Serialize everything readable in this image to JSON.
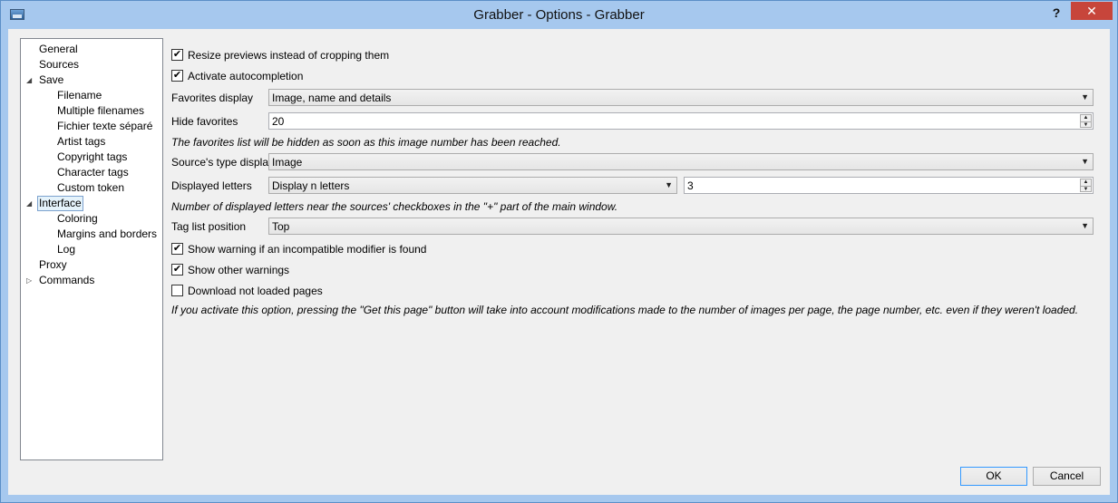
{
  "window": {
    "title": "Grabber - Options - Grabber",
    "help_label": "?",
    "close_label": "✕"
  },
  "tree": [
    {
      "label": "General",
      "arrow": ""
    },
    {
      "label": "Sources",
      "arrow": ""
    },
    {
      "label": "Save",
      "arrow": "◢"
    },
    {
      "label": "Filename",
      "arrow": ""
    },
    {
      "label": "Multiple filenames",
      "arrow": ""
    },
    {
      "label": "Fichier texte séparé",
      "arrow": ""
    },
    {
      "label": "Artist tags",
      "arrow": ""
    },
    {
      "label": "Copyright tags",
      "arrow": ""
    },
    {
      "label": "Character tags",
      "arrow": ""
    },
    {
      "label": "Custom token",
      "arrow": ""
    },
    {
      "label": "Interface",
      "arrow": "◢"
    },
    {
      "label": "Coloring",
      "arrow": ""
    },
    {
      "label": "Margins and borders",
      "arrow": ""
    },
    {
      "label": "Log",
      "arrow": ""
    },
    {
      "label": "Proxy",
      "arrow": ""
    },
    {
      "label": "Commands",
      "arrow": "▷"
    }
  ],
  "selected_tree_item": "Interface",
  "options": {
    "resize_previews": {
      "label": "Resize previews instead of cropping them",
      "checked": "✔"
    },
    "autocompletion": {
      "label": "Activate autocompletion",
      "checked": "✔"
    },
    "favorites_display": {
      "label": "Favorites display",
      "value": "Image, name and details"
    },
    "hide_favorites": {
      "label": "Hide favorites",
      "value": "20"
    },
    "hide_favorites_hint": "The favorites list will be hidden as soon as this image number has been reached.",
    "source_type_display": {
      "label": "Source's type display",
      "value": "Image"
    },
    "displayed_letters": {
      "label": "Displayed letters",
      "mode": "Display n letters",
      "value": "3"
    },
    "displayed_letters_hint": "Number of displayed letters near the sources' checkboxes in the \"+\" part of the main window.",
    "tag_list_position": {
      "label": "Tag list position",
      "value": "Top"
    },
    "incompatible_modifier": {
      "label": "Show warning if an incompatible modifier is found",
      "checked": "✔"
    },
    "other_warnings": {
      "label": "Show other warnings",
      "checked": "✔"
    },
    "download_not_loaded": {
      "label": "Download not loaded pages",
      "checked": ""
    },
    "download_hint": "If you activate this option, pressing the \"Get this page\" button will take into account modifications made to the number of images per page, the page number, etc. even if they weren't loaded."
  },
  "buttons": {
    "ok": "OK",
    "cancel": "Cancel"
  },
  "icons": {
    "dropdown": "▼",
    "spin_up": "▲",
    "spin_down": "▼"
  }
}
